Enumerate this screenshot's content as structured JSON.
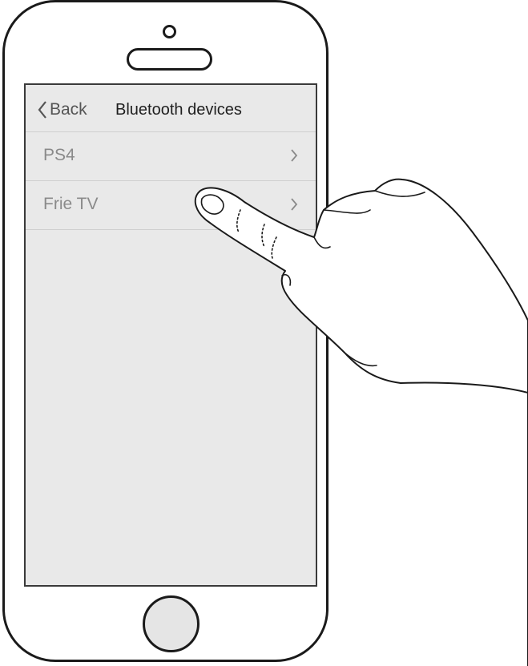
{
  "navbar": {
    "back_label": "Back",
    "title": "Bluetooth devices"
  },
  "devices": [
    {
      "label": "PS4",
      "icon": "chevron-right-icon"
    },
    {
      "label": "Frie TV",
      "icon": "chevron-right-icon"
    }
  ],
  "illustration": {
    "gesture": "hand-tapping-icon"
  },
  "colors": {
    "screen_background": "#e9e9e9",
    "device_text": "#8a8a8a",
    "title_text": "#1f1f1f",
    "outline": "#1a1a1a"
  }
}
